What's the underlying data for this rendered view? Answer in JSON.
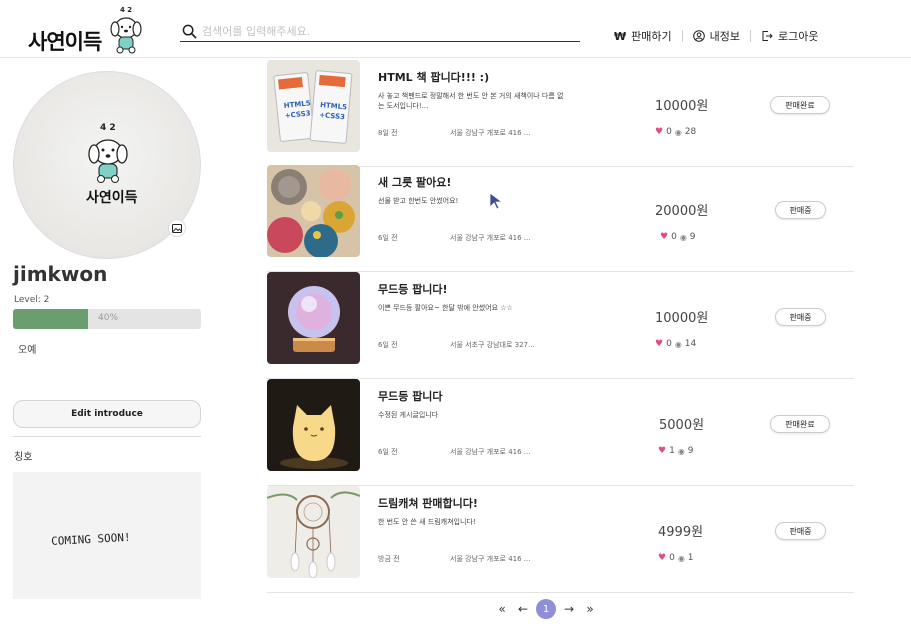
{
  "header": {
    "logo_text": "사연이득",
    "logo_numbers": "4 2",
    "search_placeholder": "검색어를 입력해주세요.",
    "nav": {
      "sell": "판매하기",
      "myinfo": "내정보",
      "logout": "로그아웃"
    }
  },
  "sidebar": {
    "avatar_logo_text": "사연이득",
    "avatar_numbers": "4 2",
    "username": "jimkwon",
    "level": "Level: 2",
    "progress_text": "40%",
    "progress_value": 0.4,
    "intro": "오예",
    "edit_button": "Edit introduce",
    "title_label": "칭호",
    "coming_soon": "COMING SOON!"
  },
  "items": [
    {
      "title": "HTML 책 팝니다!!! :)",
      "desc": "사 놓고 책펜드로 정말해서 한 번도 안 본 거의 새책이나 다름 없는 도서입니다!...",
      "time": "8일 전",
      "location": "서울 강남구 개포로 416 ...",
      "price": "10000원",
      "likes": "0",
      "views": "28",
      "status": "판매완료"
    },
    {
      "title": "새 그릇 팔아요!",
      "desc": "선물 받고 한번도 안썼어요!",
      "time": "6일 전",
      "location": "서울 강남구 개포로 416 ...",
      "price": "20000원",
      "likes": "0",
      "views": "9",
      "status": "판매중"
    },
    {
      "title": "무드등 팝니다!",
      "desc": "이쁜 무드등 팔아요~ 한달 밖에 안썼어요 ☆☆",
      "time": "6일 전",
      "location": "서울 서초구 강남대로 327...",
      "price": "10000원",
      "likes": "0",
      "views": "14",
      "status": "판매중"
    },
    {
      "title": "무드등 팝니다",
      "desc": "수정된 게시글입니다",
      "time": "6일 전",
      "location": "서울 강남구 개포로 416 ...",
      "price": "5000원",
      "likes": "1",
      "views": "9",
      "status": "판매완료"
    },
    {
      "title": "드림캐쳐 판매합니다!",
      "desc": "한 번도 안 쓴 새 드림캐쳐입니다!",
      "time": "방금 전",
      "location": "서울 강남구 개포로 416 ...",
      "price": "4999원",
      "likes": "0",
      "views": "1",
      "status": "판매중"
    }
  ],
  "pagination": {
    "first": "«",
    "prev": "←",
    "current": "1",
    "next": "→",
    "last": "»"
  },
  "colors": {
    "progress": "#6a9e6e",
    "page_active": "#8f8fd8",
    "heart": "#e0507a"
  }
}
